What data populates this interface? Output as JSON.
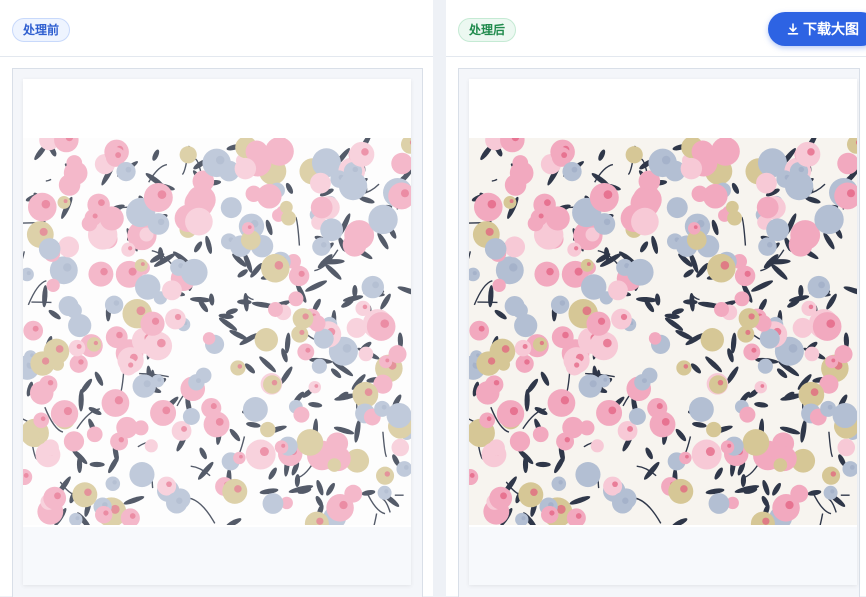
{
  "left_panel": {
    "tag_label": "处理前"
  },
  "right_panel": {
    "tag_label": "处理后",
    "download_label": "下载大图"
  },
  "pattern_colors": {
    "pink": "#f2a9bf",
    "pink_light": "#f7c9d6",
    "blue_grey": "#b3bfd3",
    "tan": "#d6c796",
    "navy_leaf": "#2f3749",
    "accent_dot": "#e25c7e"
  },
  "icons": {
    "download": "download-icon"
  }
}
